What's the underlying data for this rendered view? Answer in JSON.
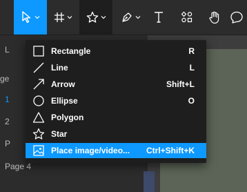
{
  "toolbar": {
    "tools": [
      {
        "name": "move-tool",
        "active": true
      },
      {
        "name": "frame-tool"
      },
      {
        "name": "shape-tools",
        "open": true
      },
      {
        "name": "pen-tool"
      },
      {
        "name": "text-tool"
      },
      {
        "name": "resources-tool"
      },
      {
        "name": "hand-tool"
      },
      {
        "name": "comment-tool"
      }
    ]
  },
  "left_panel": {
    "peek_texts": [
      "L",
      "ge",
      "1",
      "2",
      "P",
      "Page 4"
    ]
  },
  "shape_menu": {
    "items": [
      {
        "label": "Rectangle",
        "shortcut": "R",
        "icon": "rectangle-icon"
      },
      {
        "label": "Line",
        "shortcut": "L",
        "icon": "line-icon"
      },
      {
        "label": "Arrow",
        "shortcut": "Shift+L",
        "icon": "arrow-icon"
      },
      {
        "label": "Ellipse",
        "shortcut": "O",
        "icon": "ellipse-icon"
      },
      {
        "label": "Polygon",
        "shortcut": "",
        "icon": "polygon-icon"
      },
      {
        "label": "Star",
        "shortcut": "",
        "icon": "star-icon"
      },
      {
        "label": "Place image/video...",
        "shortcut": "Ctrl+Shift+K",
        "icon": "image-icon",
        "highlighted": true
      }
    ]
  },
  "colors": {
    "accent": "#0d99ff",
    "toolbar_bg": "#2c2c2c",
    "menu_bg": "#1e1e1e",
    "canvas_frame": "#5b6456"
  }
}
